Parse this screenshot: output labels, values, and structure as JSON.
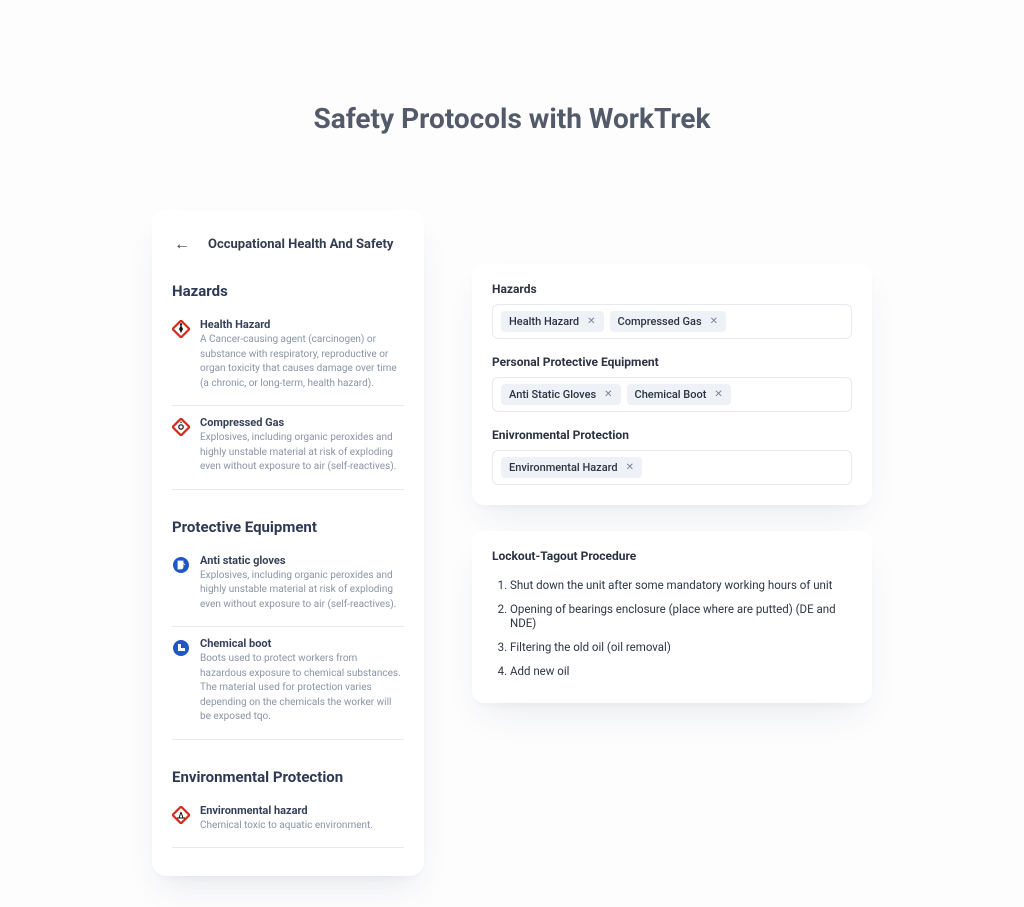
{
  "page": {
    "title": "Safety Protocols with WorkTrek"
  },
  "left": {
    "title": "Occupational Health And Safety",
    "sections": {
      "hazards": {
        "title": "Hazards",
        "items": [
          {
            "name": "Health Hazard",
            "desc": "A Cancer-causing agent (carcinogen) or substance with respiratory, reproductive or organ toxicity that causes damage over time (a chronic, or long-term, health hazard)."
          },
          {
            "name": "Compressed Gas",
            "desc": "Explosives, including organic peroxides and highly unstable material at risk of exploding even without exposure to air (self-reactives)."
          }
        ]
      },
      "ppe": {
        "title": "Protective Equipment",
        "items": [
          {
            "name": "Anti static gloves",
            "desc": "Explosives, including organic peroxides and highly unstable material at risk of exploding even without exposure to air (self-reactives)."
          },
          {
            "name": "Chemical boot",
            "desc": "Boots used to protect workers from hazardous exposure to chemical substances. The material used for protection varies depending on the chemicals the worker will be exposed tqo."
          }
        ]
      },
      "env": {
        "title": "Environmental Protection",
        "items": [
          {
            "name": "Environmental hazard",
            "desc": "Chemical toxic to aquatic environment."
          }
        ]
      }
    }
  },
  "right": {
    "fields": {
      "hazards": {
        "label": "Hazards",
        "chips": [
          "Health Hazard",
          "Compressed Gas"
        ]
      },
      "ppe": {
        "label": "Personal Protective Equipment",
        "chips": [
          "Anti Static Gloves",
          "Chemical Boot"
        ]
      },
      "env": {
        "label": "Enivronmental Protection",
        "chips": [
          "Environmental Hazard"
        ]
      }
    },
    "lockout": {
      "title": "Lockout-Tagout Procedure",
      "steps": [
        "Shut down the unit after some mandatory working hours of unit",
        "Opening of bearings enclosure (place where are putted) (DE and NDE)",
        "Filtering the old oil (oil removal)",
        "Add new oil"
      ]
    }
  }
}
